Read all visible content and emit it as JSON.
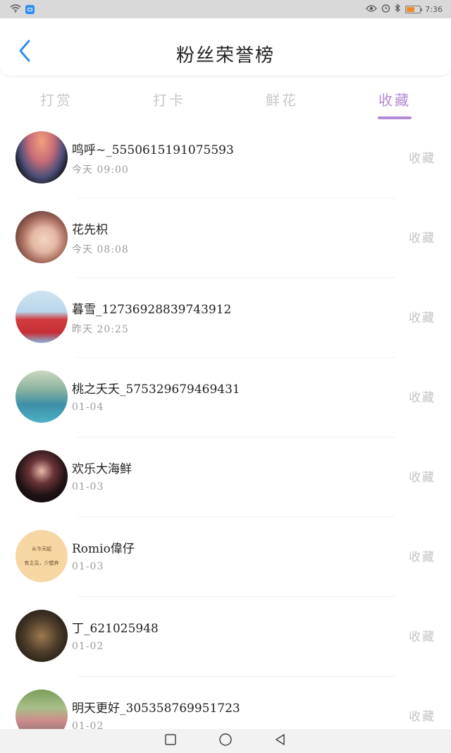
{
  "status_bar": {
    "time": "7:36",
    "icons": [
      "wifi-icon",
      "app-badge-icon",
      "eye-icon",
      "alarm-icon",
      "bluetooth-icon",
      "battery-icon"
    ],
    "battery_level": 0.6
  },
  "header": {
    "title": "粉丝荣誉榜",
    "back_icon": "chevron-left-icon"
  },
  "tabs": [
    {
      "label": "打赏",
      "active": false
    },
    {
      "label": "打卡",
      "active": false
    },
    {
      "label": "鲜花",
      "active": false
    },
    {
      "label": "收藏",
      "active": true
    }
  ],
  "colors": {
    "accent": "#b28ad6",
    "back_arrow": "#2f8df5",
    "muted": "#c4c4c4"
  },
  "list": {
    "action_label": "收藏",
    "items": [
      {
        "name": "鸣呼~_5550615191075593",
        "time": "今天 09:00"
      },
      {
        "name": "花先枳",
        "time": "今天 08:08"
      },
      {
        "name": "暮雪_12736928839743912",
        "time": "昨天 20:25"
      },
      {
        "name": "桃之夭夭_575329679469431",
        "time": "01-04"
      },
      {
        "name": "欢乐大海鲜",
        "time": "01-03"
      },
      {
        "name": "Romio偉仔",
        "time": "01-03",
        "avatar_text": [
          "从今天起",
          "有主见，少塑弃"
        ]
      },
      {
        "name": "丁_621025948",
        "time": "01-02"
      },
      {
        "name": "明天更好_305358769951723",
        "time": "01-02"
      }
    ]
  },
  "nav_bar": {
    "buttons": [
      "recents-icon",
      "home-icon",
      "back-icon"
    ]
  }
}
